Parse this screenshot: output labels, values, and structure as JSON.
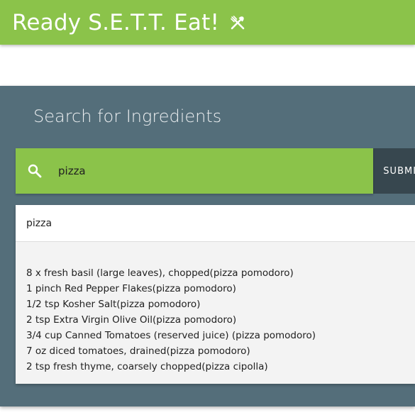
{
  "app": {
    "title": "Ready S.E.T.T. Eat!",
    "title_icon": "fork-knife-icon",
    "brand_color": "#8bc34a"
  },
  "search_panel": {
    "heading": "Search for Ingredients",
    "search_icon": "search-icon",
    "query_value": "pizza",
    "submit_label": "SUBMIT",
    "panel_color": "#546e7a",
    "button_color": "#37474f"
  },
  "results": {
    "query_label": "pizza",
    "items": [
      "8 x fresh basil (large leaves), chopped(pizza pomodoro)",
      "1 pinch Red Pepper Flakes(pizza pomodoro)",
      "1/2 tsp Kosher Salt(pizza pomodoro)",
      "2 tsp Extra Virgin Olive Oil(pizza pomodoro)",
      "3/4 cup Canned Tomatoes (reserved juice) (pizza pomodoro)",
      "7 oz diced tomatoes, drained(pizza pomodoro)",
      "2 tsp fresh thyme, coarsely chopped(pizza cipolla)"
    ]
  }
}
